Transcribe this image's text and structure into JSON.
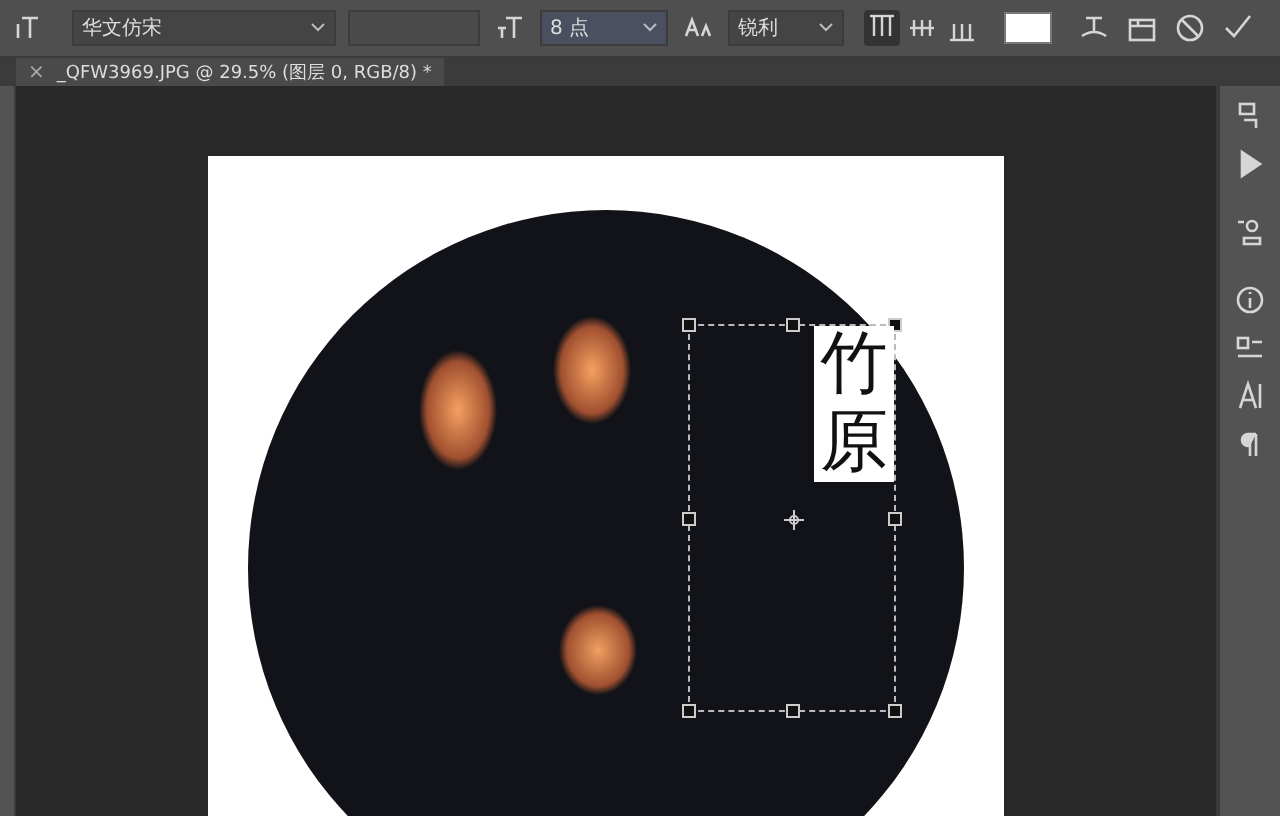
{
  "options_bar": {
    "font_family": "华文仿宋",
    "font_size": "8 点",
    "anti_alias": "锐利",
    "alignment": [
      {
        "kind": "left",
        "selected": true
      },
      {
        "kind": "center",
        "selected": false
      },
      {
        "kind": "right",
        "selected": false
      }
    ]
  },
  "document_tab": {
    "title": "_QFW3969.JPG @ 29.5% (图层 0, RGB/8) *",
    "close": "×"
  },
  "canvas": {
    "text_layer": "竹原"
  }
}
